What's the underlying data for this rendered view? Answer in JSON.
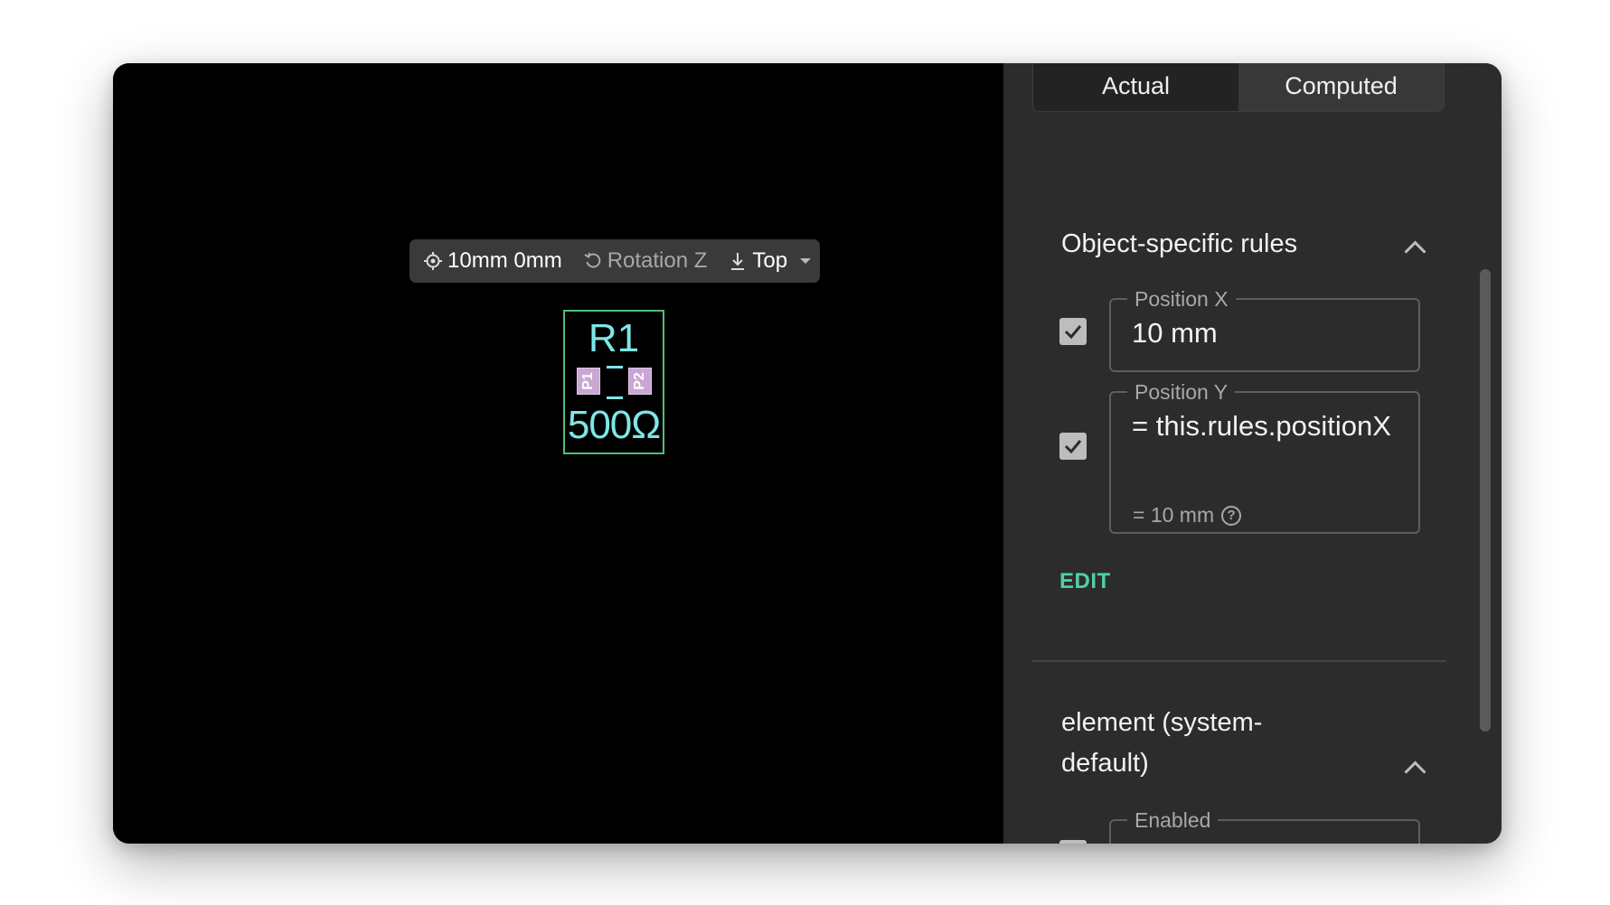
{
  "toolbar": {
    "position": "10mm 0mm",
    "rotation": "Rotation Z",
    "layer": "Top"
  },
  "component": {
    "reference": "R1",
    "value": "500Ω",
    "pad1": "P1",
    "pad2": "P2"
  },
  "panel": {
    "tabs": [
      {
        "label": "Actual",
        "active": true
      },
      {
        "label": "Computed",
        "active": false
      }
    ],
    "object_rules": {
      "title": "Object-specific rules",
      "position_x": {
        "label": "Position X",
        "value": "10 mm",
        "checked": true
      },
      "position_y": {
        "label": "Position Y",
        "value": "= this.rules.positionX",
        "checked": true
      },
      "computed_hint": "= 10 mm",
      "edit_label": "EDIT"
    },
    "element_rules": {
      "title": "element (system-default)",
      "enabled_label": "Enabled"
    }
  },
  "colors": {
    "accent": "#4fd1a6",
    "silkscreen": "#7ee6e6",
    "outline": "#4cc07a",
    "pad": "#c9a6d4"
  }
}
